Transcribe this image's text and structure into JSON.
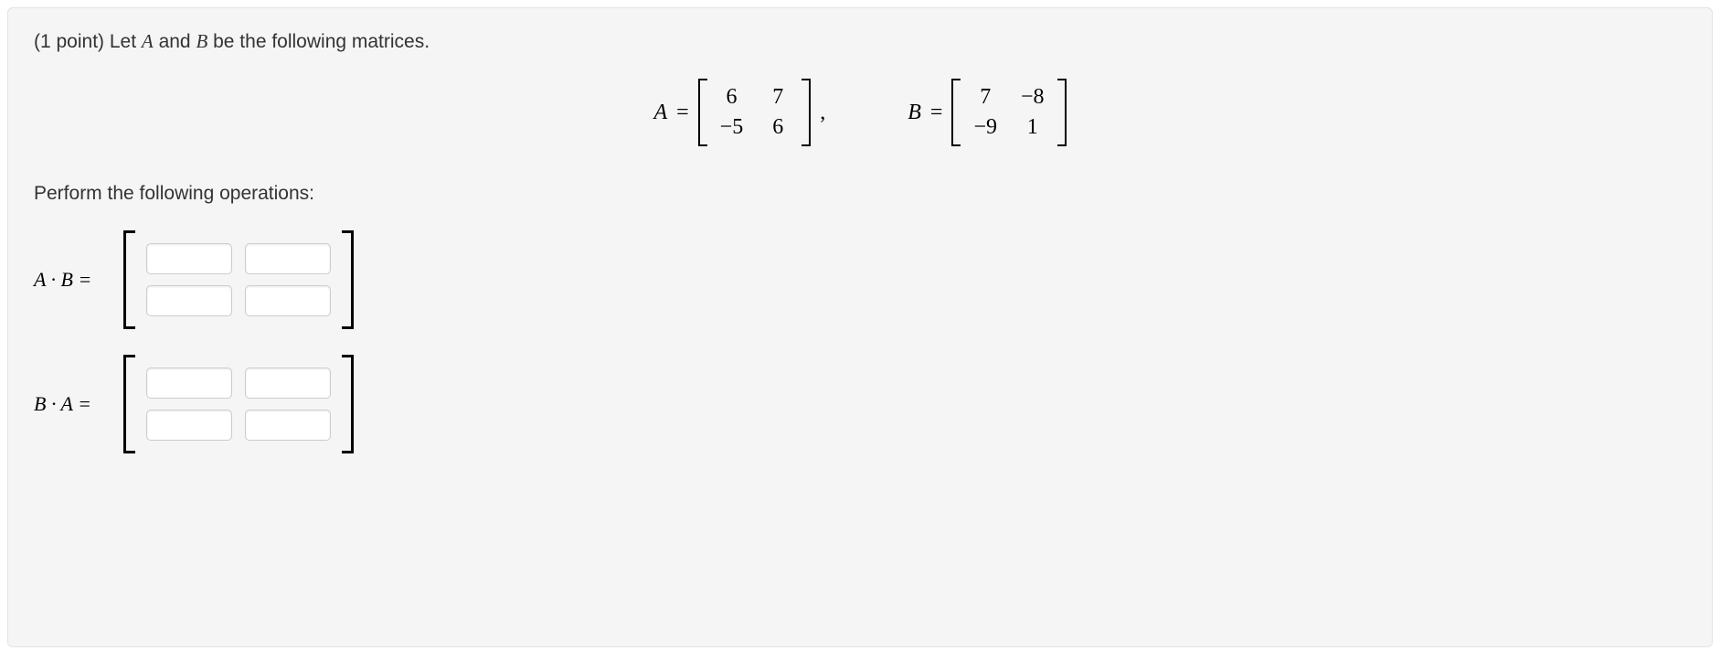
{
  "problem": {
    "points_prefix": "(1 point) ",
    "intro_part1": "Let ",
    "var_A": "A",
    "intro_and": " and ",
    "var_B": "B",
    "intro_part2": " be the following matrices."
  },
  "matrices": {
    "A_label": "A",
    "eq": "=",
    "A": [
      [
        "6",
        "7"
      ],
      [
        "−5",
        "6"
      ]
    ],
    "comma": ",",
    "B_label": "B",
    "B": [
      [
        "7",
        "−8"
      ],
      [
        "−9",
        "1"
      ]
    ]
  },
  "operations_line": "Perform the following operations:",
  "answers": {
    "AB_label": "A · B =",
    "BA_label": "B · A =",
    "AB_values": [
      [
        "",
        ""
      ],
      [
        "",
        ""
      ]
    ],
    "BA_values": [
      [
        "",
        ""
      ],
      [
        "",
        ""
      ]
    ]
  }
}
